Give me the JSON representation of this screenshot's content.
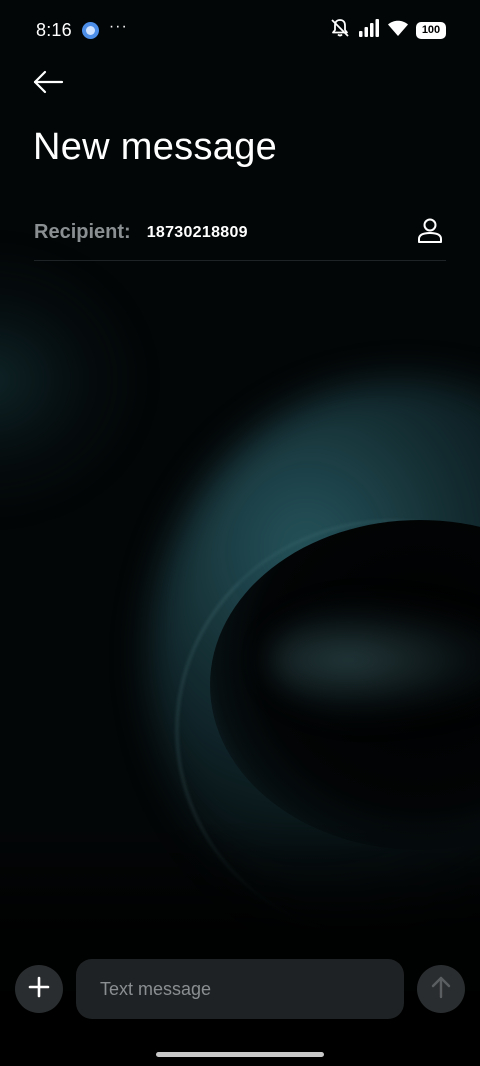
{
  "status_bar": {
    "time": "8:16",
    "notification_icon": "app-notification-icon",
    "more": "···",
    "icons": [
      "mute-icon",
      "signal-icon",
      "wifi-icon"
    ],
    "battery": "100"
  },
  "header": {
    "back_icon": "back-arrow-icon",
    "title": "New message"
  },
  "recipient": {
    "label": "Recipient:",
    "value": "18730218809",
    "contact_icon": "contact-person-icon"
  },
  "composer": {
    "attach_icon": "plus-icon",
    "placeholder": "Text message",
    "send_icon": "send-arrow-icon"
  },
  "colors": {
    "background": "#030607",
    "label_gray": "#8a8f91",
    "input_bg": "#1f2224",
    "button_bg": "#2a2d2f",
    "wallpaper_accent": "#326e78"
  }
}
